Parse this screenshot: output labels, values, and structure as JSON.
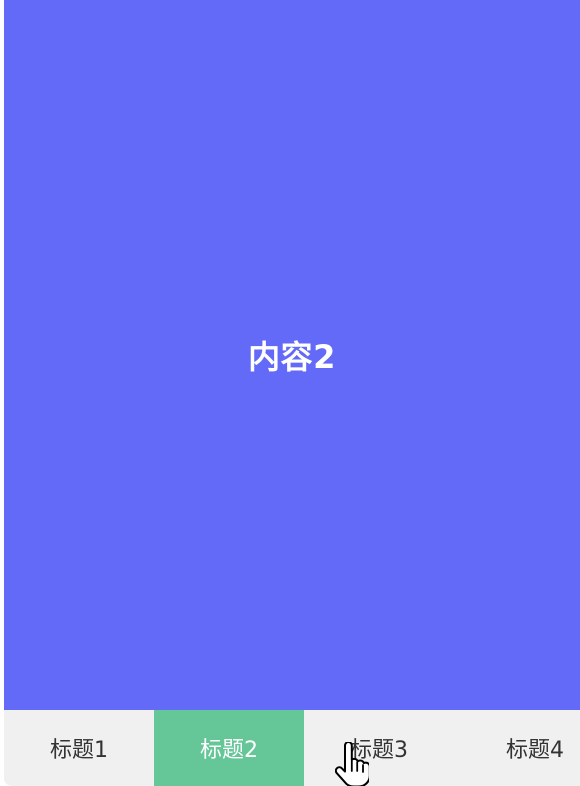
{
  "content": {
    "text": "内容2",
    "background": "#626af7",
    "text_color": "#ffffff"
  },
  "tabs": [
    {
      "label": "标题1",
      "active": false
    },
    {
      "label": "标题2",
      "active": true
    },
    {
      "label": "标题3",
      "active": false
    },
    {
      "label": "标题4",
      "active": false
    }
  ],
  "colors": {
    "tab_bar_background": "#f0f0f0",
    "active_tab_background": "#65c697",
    "inactive_tab_text": "#333333",
    "active_tab_text": "#ffffff"
  },
  "cursor": {
    "icon": "hand-pointer-icon"
  }
}
